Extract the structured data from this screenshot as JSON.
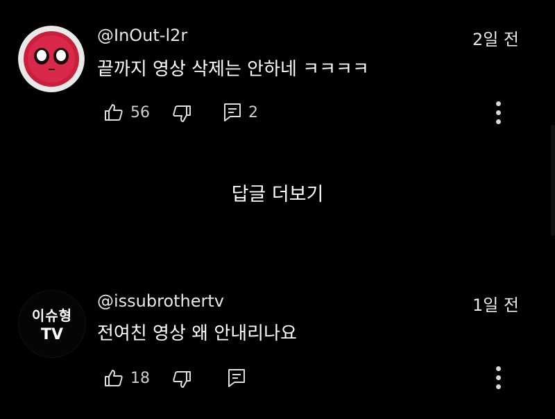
{
  "comments": [
    {
      "username": "@InOut-l2r",
      "time": "2일 전",
      "text": "끝까지 영상 삭제는 안하네 ㅋㅋㅋㅋ",
      "likes": "56",
      "replies": "2",
      "avatar_icon": "deadpool-mask-icon"
    },
    {
      "username": "@issubrothertv",
      "time": "1일 전",
      "text": "전여친 영상 왜 안내리나요",
      "likes": "18",
      "replies": "",
      "avatar_line1": "이슈형",
      "avatar_line2": "TV"
    }
  ],
  "more_replies_label": "답글 더보기",
  "icons": [
    "thumbs-up-icon",
    "thumbs-down-icon",
    "reply-icon",
    "more-vert-icon"
  ]
}
